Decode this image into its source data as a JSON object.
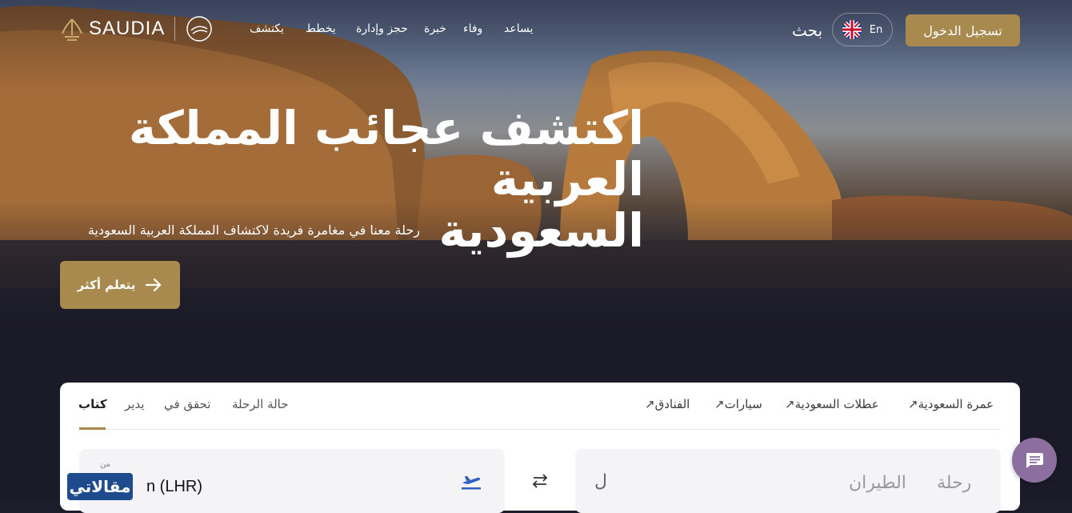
{
  "nav": {
    "logo_text": "SAUDIA",
    "menu": [
      "يساعد",
      "وفاء",
      "خبرة",
      "حجز وإدارة",
      "يخطط",
      "يكتشف"
    ],
    "search_label": "بحث",
    "language_label": "En",
    "login_label": "تسجيل الدخول"
  },
  "hero": {
    "headline_line1": "اكتشف عجائب المملكة العربية",
    "headline_line2": "السعودية",
    "subtitle": "رحلة معنا في مغامرة فريدة لاكتشاف المملكة العربية السعودية",
    "cta_label": "يتعلم أكثر"
  },
  "booking": {
    "quick_links": [
      "↗عمرة السعودية",
      "↗عطلات السعودية",
      "↗سيارات",
      "↗الفنادق"
    ],
    "tabs": [
      "كتاب",
      "يدير",
      "تحقق في",
      "حالة الرحلة"
    ],
    "active_tab": "كتاب",
    "from_label": "من",
    "from_value": "n (LHR)",
    "to_placeholder": "ل",
    "trip_types": [
      "رحلة",
      "الطيران"
    ]
  },
  "watermark": "مقالاتي",
  "colors": {
    "accent": "#a88a4f",
    "chat_button": "#8c6f9e",
    "watermark_bg": "#1e4a8e",
    "plane_icon": "#2f5fc4"
  },
  "icons": [
    "saudia-logo-icon",
    "skyteam-icon",
    "uk-flag-icon",
    "arrow-right-icon",
    "plane-takeoff-icon",
    "swap-icon",
    "chat-icon"
  ]
}
